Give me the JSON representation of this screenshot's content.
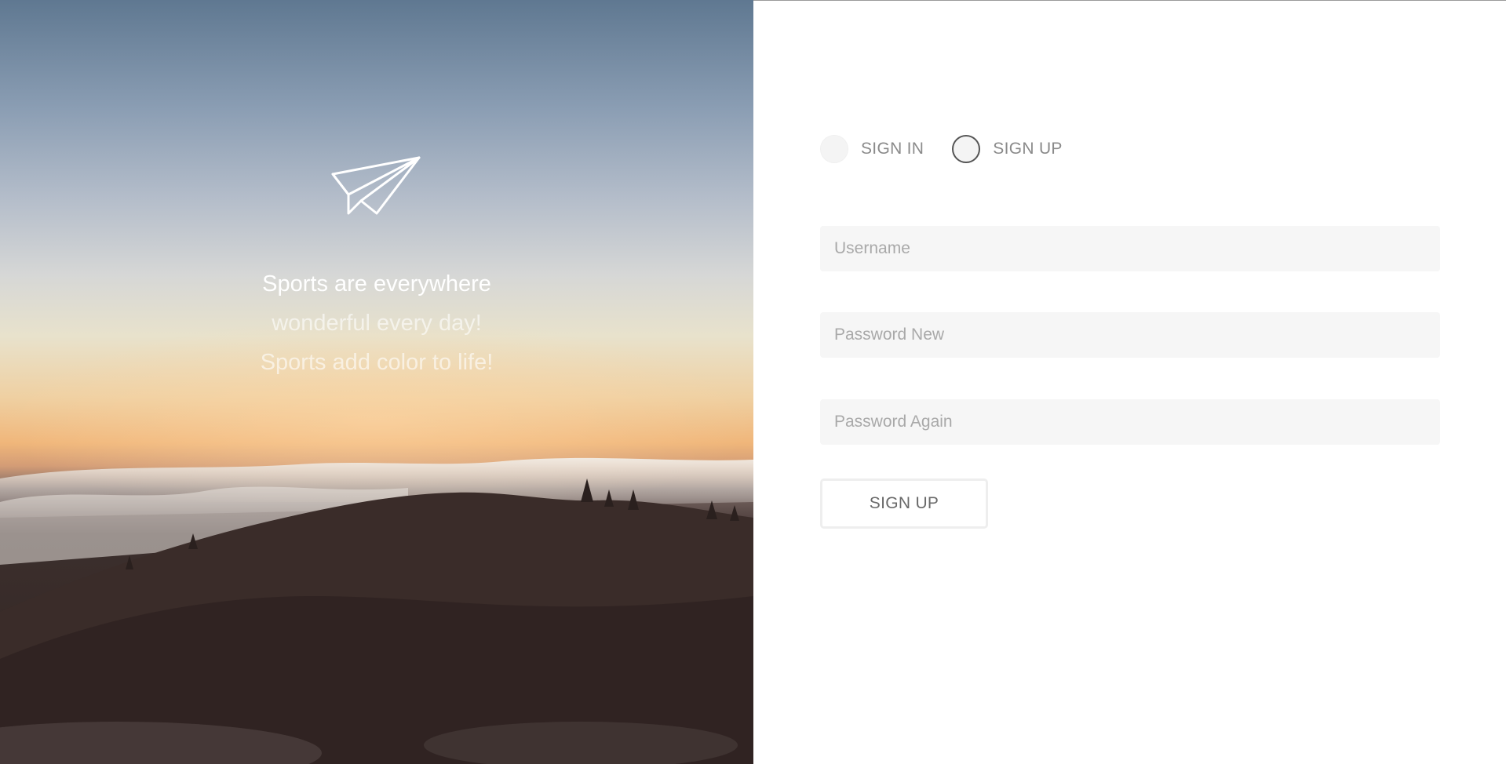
{
  "hero": {
    "icon": "paper-plane-icon",
    "taglines": [
      "Sports are everywhere",
      "wonderful every day!",
      "Sports add color to life!"
    ]
  },
  "auth": {
    "tabs": [
      {
        "label": "SIGN IN",
        "selected": false
      },
      {
        "label": "SIGN UP",
        "selected": true
      }
    ],
    "fields": [
      {
        "placeholder": "Username",
        "value": ""
      },
      {
        "placeholder": "Password New",
        "value": ""
      },
      {
        "placeholder": "Password Again",
        "value": ""
      }
    ],
    "submit_label": "SIGN UP"
  },
  "colors": {
    "field_bg": "#f6f6f6",
    "label": "#8a8a8a",
    "radio_ring": "#555555"
  }
}
